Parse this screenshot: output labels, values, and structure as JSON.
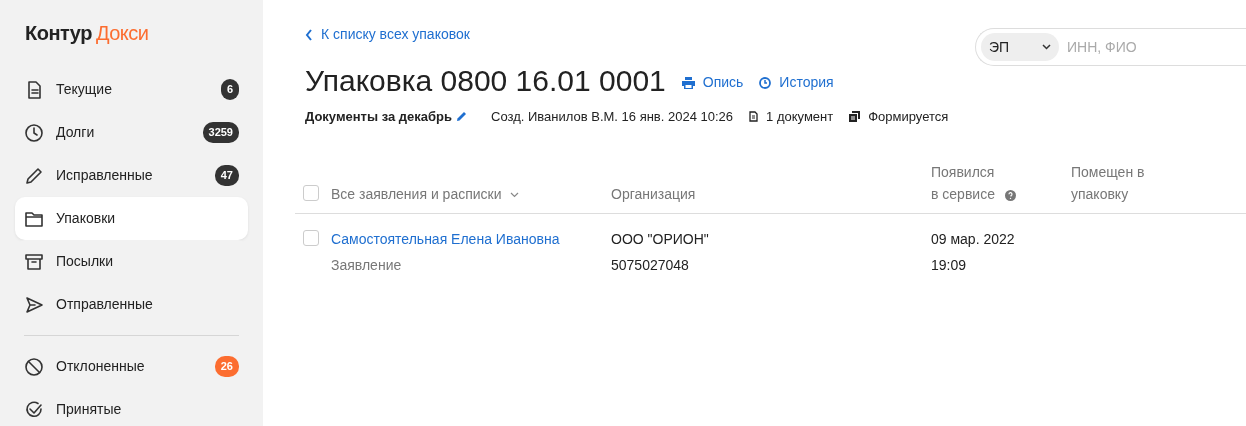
{
  "logo": {
    "brand": "Контур",
    "product": "Докси"
  },
  "sidebar": {
    "sections": [
      [
        {
          "label": "Текущие",
          "badge": "6",
          "color": "#333333",
          "selected": false
        },
        {
          "label": "Долги",
          "badge": "3259",
          "color": "#333333",
          "selected": false
        },
        {
          "label": "Исправленные",
          "badge": "47",
          "color": "#333333",
          "selected": false
        },
        {
          "label": "Упаковки",
          "selected": true
        },
        {
          "label": "Посылки",
          "selected": false
        },
        {
          "label": "Отправленные",
          "selected": false
        }
      ],
      [
        {
          "label": "Отклоненные",
          "badge": "26",
          "color": "#fc6d30",
          "selected": false
        },
        {
          "label": "Принятые",
          "selected": false
        }
      ]
    ]
  },
  "back_link": "К списку всех упаковок",
  "search": {
    "filter": "ЭП",
    "placeholder": "ИНН, ФИО"
  },
  "title": "Упаковка 0800 16.01 0001",
  "title_links": [
    "Опись",
    "История"
  ],
  "meta": {
    "name": "Документы за декабрь",
    "created": "Созд. Иванилов В.М. 16 янв. 2024 10:26",
    "count": "1 документ",
    "status": "Формируется"
  },
  "table": {
    "select_all": {
      "checked": false
    },
    "columns": [
      "Все заявления и расписки",
      "Организация",
      "Появился в сервисе",
      "Помещен в упаковку"
    ],
    "rows": [
      {
        "checked": false,
        "name": "Самостоятельная Елена Ивановна",
        "type": "Заявление",
        "org": "ООО \"ОРИОН\"",
        "inn": "5075027048",
        "date": "09 мар. 2022",
        "time": "19:09"
      }
    ]
  }
}
